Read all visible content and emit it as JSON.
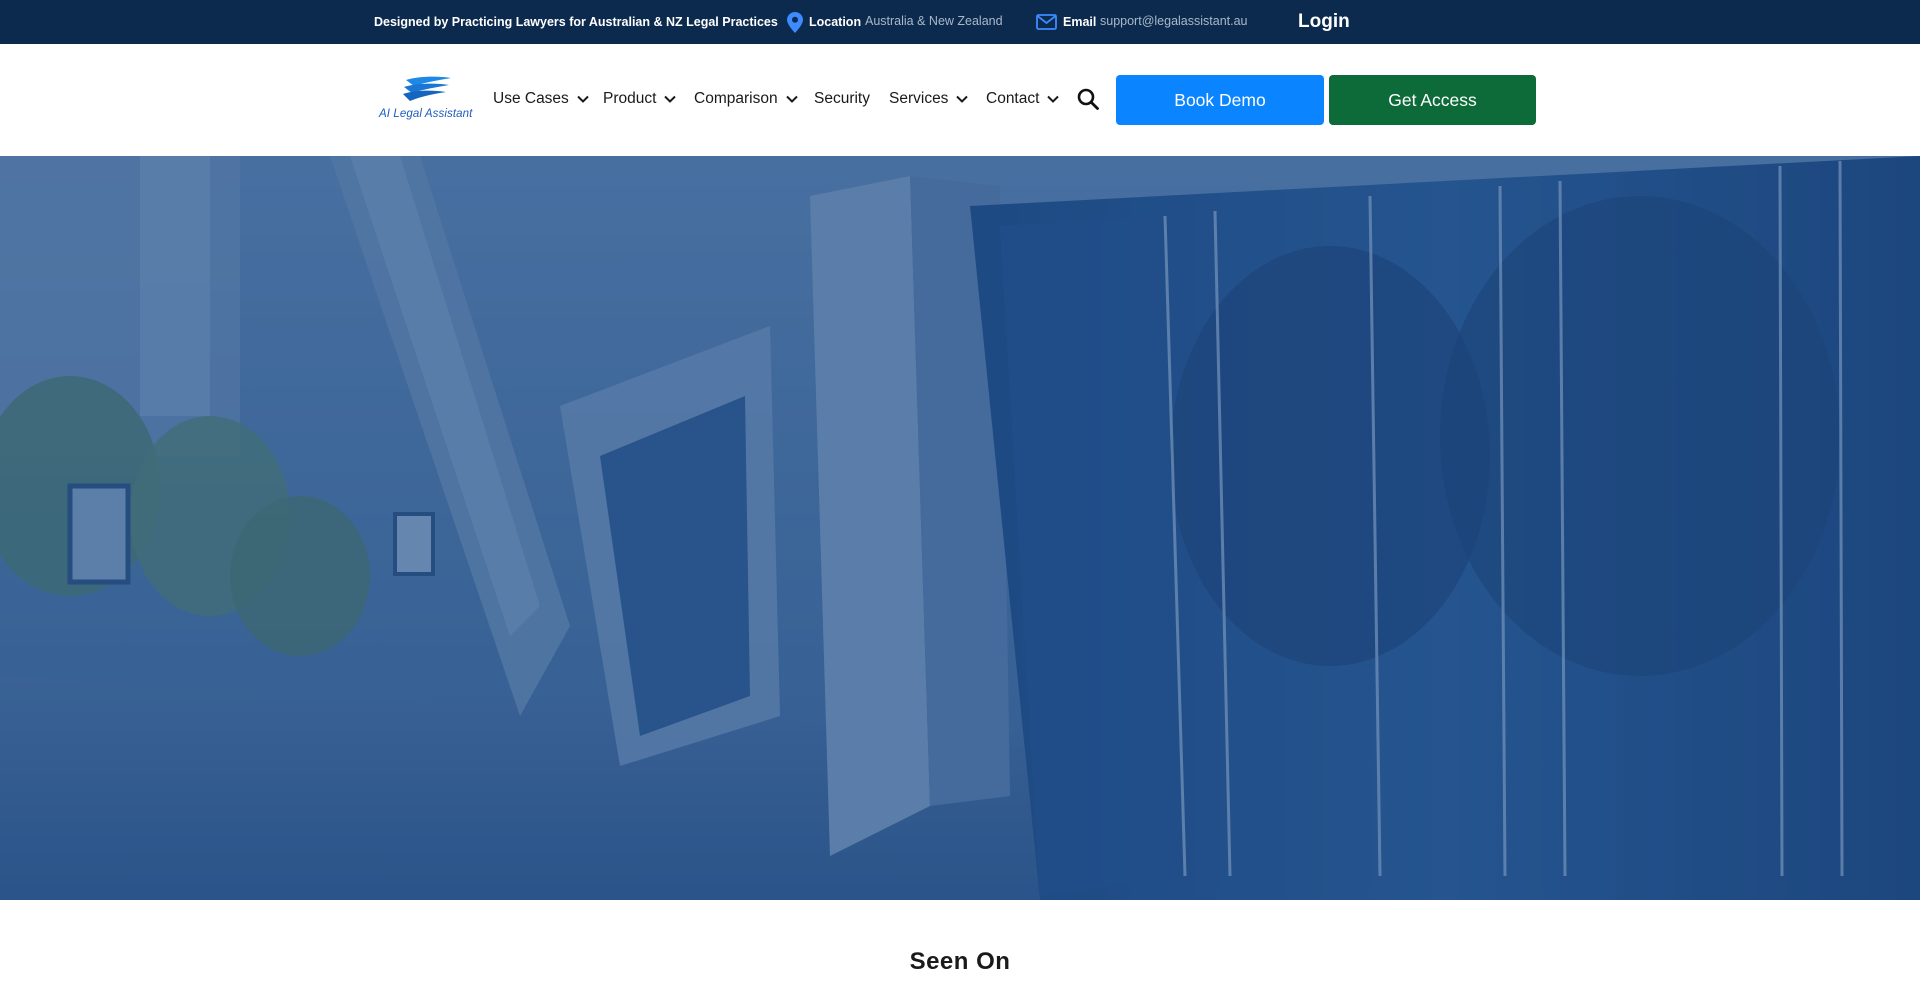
{
  "topbar": {
    "tagline": "Designed by Practicing Lawyers for Australian & NZ Legal Practices",
    "location_icon": "map-pin-icon",
    "location_title": "Location",
    "location_value": "Australia & New Zealand",
    "email_icon": "envelope-icon",
    "email_title": "Email",
    "email_value": "support@legalassistant.au",
    "login_label": "Login"
  },
  "header": {
    "logo_text": "AI Legal Assistant",
    "nav": [
      {
        "label": "Use Cases",
        "dropdown": true
      },
      {
        "label": "Product",
        "dropdown": true
      },
      {
        "label": "Comparison",
        "dropdown": true
      },
      {
        "label": "Security",
        "dropdown": false
      },
      {
        "label": "Services",
        "dropdown": true
      },
      {
        "label": "Contact",
        "dropdown": true
      }
    ],
    "search_icon": "search-icon",
    "book_demo_label": "Book Demo",
    "get_access_label": "Get Access"
  },
  "colors": {
    "topbar_bg": "#0b2a4e",
    "primary_blue": "#0a84ff",
    "access_green": "#0c6b38",
    "hero_overlay": "#1c4a8a"
  },
  "seen_on": {
    "heading": "Seen On"
  }
}
